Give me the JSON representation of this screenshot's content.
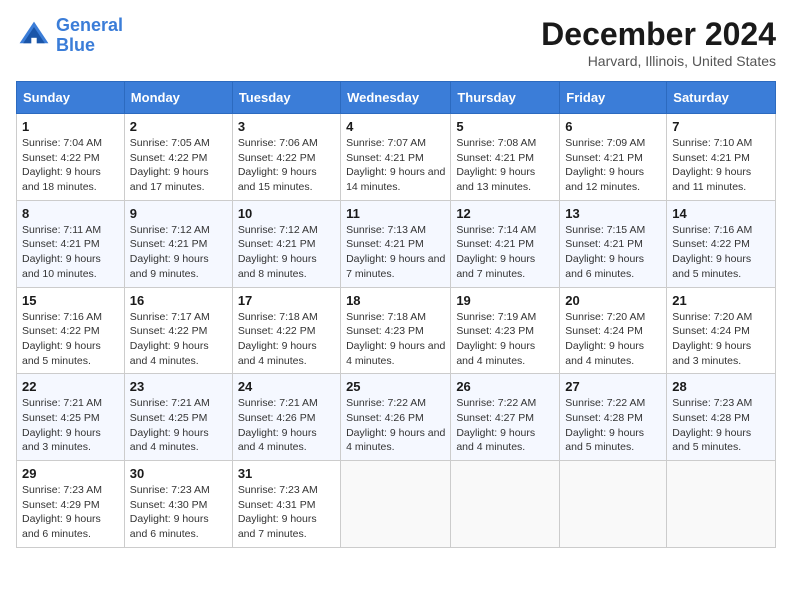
{
  "header": {
    "logo_line1": "General",
    "logo_line2": "Blue",
    "month": "December 2024",
    "location": "Harvard, Illinois, United States"
  },
  "days_of_week": [
    "Sunday",
    "Monday",
    "Tuesday",
    "Wednesday",
    "Thursday",
    "Friday",
    "Saturday"
  ],
  "weeks": [
    [
      {
        "day": "1",
        "sunrise": "7:04 AM",
        "sunset": "4:22 PM",
        "daylight": "9 hours and 18 minutes."
      },
      {
        "day": "2",
        "sunrise": "7:05 AM",
        "sunset": "4:22 PM",
        "daylight": "9 hours and 17 minutes."
      },
      {
        "day": "3",
        "sunrise": "7:06 AM",
        "sunset": "4:22 PM",
        "daylight": "9 hours and 15 minutes."
      },
      {
        "day": "4",
        "sunrise": "7:07 AM",
        "sunset": "4:21 PM",
        "daylight": "9 hours and 14 minutes."
      },
      {
        "day": "5",
        "sunrise": "7:08 AM",
        "sunset": "4:21 PM",
        "daylight": "9 hours and 13 minutes."
      },
      {
        "day": "6",
        "sunrise": "7:09 AM",
        "sunset": "4:21 PM",
        "daylight": "9 hours and 12 minutes."
      },
      {
        "day": "7",
        "sunrise": "7:10 AM",
        "sunset": "4:21 PM",
        "daylight": "9 hours and 11 minutes."
      }
    ],
    [
      {
        "day": "8",
        "sunrise": "7:11 AM",
        "sunset": "4:21 PM",
        "daylight": "9 hours and 10 minutes."
      },
      {
        "day": "9",
        "sunrise": "7:12 AM",
        "sunset": "4:21 PM",
        "daylight": "9 hours and 9 minutes."
      },
      {
        "day": "10",
        "sunrise": "7:12 AM",
        "sunset": "4:21 PM",
        "daylight": "9 hours and 8 minutes."
      },
      {
        "day": "11",
        "sunrise": "7:13 AM",
        "sunset": "4:21 PM",
        "daylight": "9 hours and 7 minutes."
      },
      {
        "day": "12",
        "sunrise": "7:14 AM",
        "sunset": "4:21 PM",
        "daylight": "9 hours and 7 minutes."
      },
      {
        "day": "13",
        "sunrise": "7:15 AM",
        "sunset": "4:21 PM",
        "daylight": "9 hours and 6 minutes."
      },
      {
        "day": "14",
        "sunrise": "7:16 AM",
        "sunset": "4:22 PM",
        "daylight": "9 hours and 5 minutes."
      }
    ],
    [
      {
        "day": "15",
        "sunrise": "7:16 AM",
        "sunset": "4:22 PM",
        "daylight": "9 hours and 5 minutes."
      },
      {
        "day": "16",
        "sunrise": "7:17 AM",
        "sunset": "4:22 PM",
        "daylight": "9 hours and 4 minutes."
      },
      {
        "day": "17",
        "sunrise": "7:18 AM",
        "sunset": "4:22 PM",
        "daylight": "9 hours and 4 minutes."
      },
      {
        "day": "18",
        "sunrise": "7:18 AM",
        "sunset": "4:23 PM",
        "daylight": "9 hours and 4 minutes."
      },
      {
        "day": "19",
        "sunrise": "7:19 AM",
        "sunset": "4:23 PM",
        "daylight": "9 hours and 4 minutes."
      },
      {
        "day": "20",
        "sunrise": "7:20 AM",
        "sunset": "4:24 PM",
        "daylight": "9 hours and 4 minutes."
      },
      {
        "day": "21",
        "sunrise": "7:20 AM",
        "sunset": "4:24 PM",
        "daylight": "9 hours and 3 minutes."
      }
    ],
    [
      {
        "day": "22",
        "sunrise": "7:21 AM",
        "sunset": "4:25 PM",
        "daylight": "9 hours and 3 minutes."
      },
      {
        "day": "23",
        "sunrise": "7:21 AM",
        "sunset": "4:25 PM",
        "daylight": "9 hours and 4 minutes."
      },
      {
        "day": "24",
        "sunrise": "7:21 AM",
        "sunset": "4:26 PM",
        "daylight": "9 hours and 4 minutes."
      },
      {
        "day": "25",
        "sunrise": "7:22 AM",
        "sunset": "4:26 PM",
        "daylight": "9 hours and 4 minutes."
      },
      {
        "day": "26",
        "sunrise": "7:22 AM",
        "sunset": "4:27 PM",
        "daylight": "9 hours and 4 minutes."
      },
      {
        "day": "27",
        "sunrise": "7:22 AM",
        "sunset": "4:28 PM",
        "daylight": "9 hours and 5 minutes."
      },
      {
        "day": "28",
        "sunrise": "7:23 AM",
        "sunset": "4:28 PM",
        "daylight": "9 hours and 5 minutes."
      }
    ],
    [
      {
        "day": "29",
        "sunrise": "7:23 AM",
        "sunset": "4:29 PM",
        "daylight": "9 hours and 6 minutes."
      },
      {
        "day": "30",
        "sunrise": "7:23 AM",
        "sunset": "4:30 PM",
        "daylight": "9 hours and 6 minutes."
      },
      {
        "day": "31",
        "sunrise": "7:23 AM",
        "sunset": "4:31 PM",
        "daylight": "9 hours and 7 minutes."
      },
      null,
      null,
      null,
      null
    ]
  ]
}
